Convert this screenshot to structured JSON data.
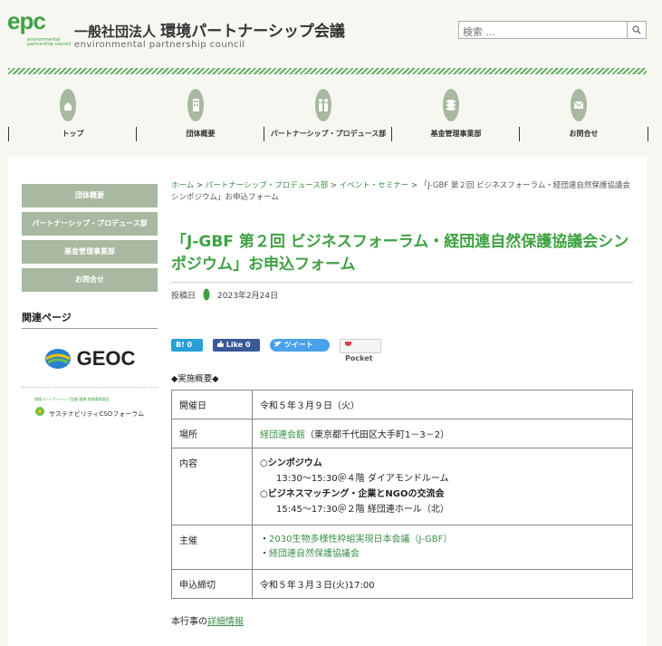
{
  "header": {
    "logo_text": "epc",
    "logo_sub": "environmental partnership council",
    "org_prefix": "一般社団法人",
    "org_name": "環境パートナーシップ会議",
    "org_en": "environmental partnership council",
    "search_placeholder": "検索 ..."
  },
  "gnav": [
    {
      "label": "トップ",
      "icon": "home-icon"
    },
    {
      "label": "団体概要",
      "icon": "building-icon"
    },
    {
      "label": "パートナーシップ・プロデュース部",
      "icon": "people-icon"
    },
    {
      "label": "基金管理事業部",
      "icon": "coin-icon"
    },
    {
      "label": "お問合せ",
      "icon": "mail-icon"
    }
  ],
  "sidebar": {
    "items": [
      "団体概要",
      "パートナーシップ・プロデュース部",
      "基金管理事業部",
      "お問合せ"
    ],
    "related_heading": "関連ページ",
    "geoc_label": "GEOC",
    "cso_tagline": "環境パートナーシップ会議 連携 地球環境基金",
    "cso_label": "サステナビリティCSOフォーラム"
  },
  "breadcrumb": {
    "home": "ホーム",
    "sep": ">",
    "level1": "パートナーシップ・プロデュース部",
    "level2": "イベント・セミナー",
    "current": "「J-GBF 第２回 ビジネスフォーラム・経団連自然保護協議会シンポジウム」お申込フォーム"
  },
  "post": {
    "title": "「J-GBF 第２回 ビジネスフォーラム・経団連自然保護協議会シンポジウム」お申込フォーム",
    "date_label": "投稿日",
    "date": "2023年2月24日"
  },
  "social": {
    "hatena": "B! 0",
    "facebook": "Like 0",
    "twitter": "ツイート",
    "pocket": "Pocket"
  },
  "section_heading": "◆実施概要◆",
  "table": {
    "date_key": "開催日",
    "date_val": "令和５年３月９日（火）",
    "place_key": "場所",
    "place_link": "経団連会館",
    "place_rest": "（東京都千代田区大手町1－3－2）",
    "content_key": "内容",
    "content_1": "○シンポジウム",
    "content_1_time": "13:30～15:30＠４階 ダイアモンドルーム",
    "content_2": "○ビジネスマッチング・企業とNGOの交流会",
    "content_2_time": "15:45～17:30＠２階 経団連ホール（北）",
    "host_key": "主催",
    "host_1": "2030生物多様性枠組実現日本会議（J-GBF）",
    "host_2": "経団連自然保護協議会",
    "host_bullet": "・",
    "deadline_key": "申込締切",
    "deadline_val": "令和５年３月３日(火)17:00"
  },
  "detail": {
    "prefix": "本行事の",
    "link": "詳細情報"
  }
}
